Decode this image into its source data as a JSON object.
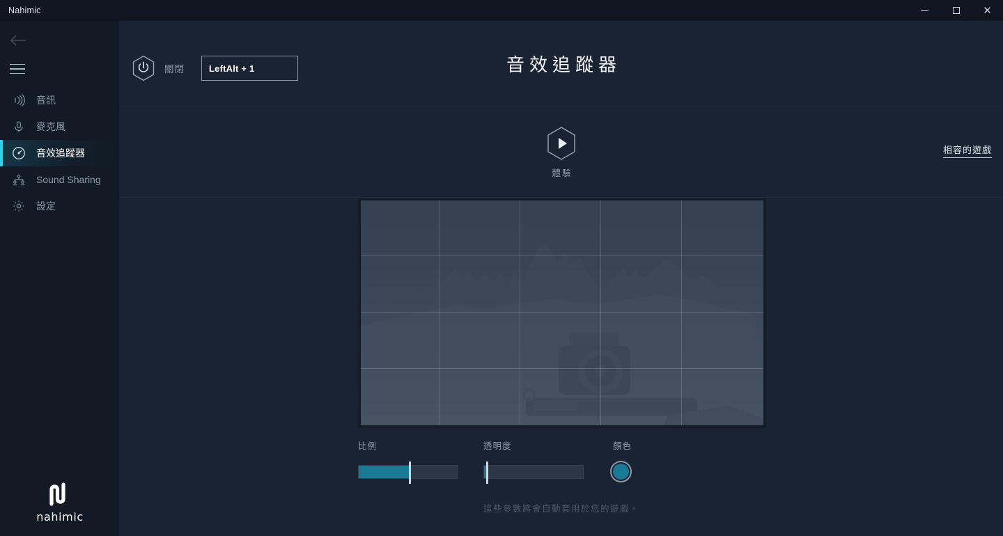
{
  "window": {
    "title": "Nahimic",
    "controls": {
      "minimize": "minimize-icon",
      "maximize": "maximize-icon",
      "close": "close-icon"
    }
  },
  "sidebar": {
    "back_icon": "back-arrow-icon",
    "menu_icon": "hamburger-icon",
    "items": [
      {
        "id": "audio",
        "label": "音訊",
        "icon": "sound-waves-icon",
        "active": false
      },
      {
        "id": "microphone",
        "label": "麥克風",
        "icon": "microphone-icon",
        "active": false
      },
      {
        "id": "sound-tracker",
        "label": "音效追蹤器",
        "icon": "sound-tracker-icon",
        "active": true
      },
      {
        "id": "sound-sharing",
        "label": "Sound Sharing",
        "icon": "share-nodes-icon",
        "active": false
      },
      {
        "id": "settings",
        "label": "設定",
        "icon": "gear-icon",
        "active": false
      }
    ],
    "brand": {
      "logo_icon": "nahimic-logo-icon",
      "wordmark": "nahimic"
    }
  },
  "header": {
    "power_icon": "power-hexagon-icon",
    "power_state": "關閉",
    "shortcut_value": "LeftAlt + 1",
    "title": "音效追蹤器"
  },
  "demo": {
    "play_icon": "play-hexagon-icon",
    "label": "體驗",
    "compatible_games_link": "相容的遊戲"
  },
  "preview": {
    "name": "sound-tracker-overlay-preview",
    "grid_columns": 5,
    "grid_rows": 4
  },
  "controls": {
    "scale": {
      "label": "比例",
      "value_percent": 52
    },
    "transparency": {
      "label": "透明度",
      "value_percent": 3
    },
    "color": {
      "label": "顏色",
      "value_hex": "#1a7a96"
    }
  },
  "footer": {
    "hint": "這些參數將會自動套用於您的遊戲。"
  },
  "theme": {
    "accent": "#1a7a96",
    "active_bar": "#2bd3e8",
    "sidebar_bg": "#121a25",
    "main_bg": "#1a2331",
    "titlebar_bg": "#0f1620"
  }
}
